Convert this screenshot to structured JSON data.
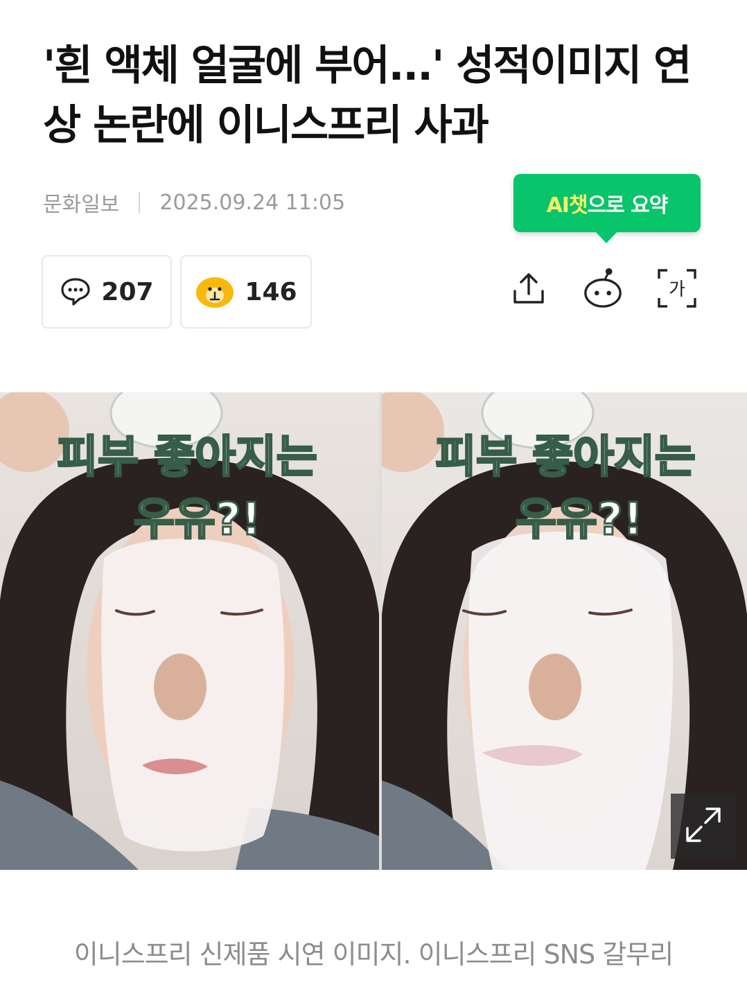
{
  "article": {
    "title": "'흰 액체 얼굴에 부어...' 성적이미지 연상 논란에 이니스프리 사과",
    "source": "문화일보",
    "datetime": "2025.09.24 11:05"
  },
  "ai_summary": {
    "highlight": "AI챗",
    "rest": "으로 요약"
  },
  "stats": {
    "comments": "207",
    "reactions": "146"
  },
  "toolbar": {
    "icons": [
      "share-icon",
      "bot-icon",
      "font-size-icon"
    ],
    "font_glyph": "가"
  },
  "photo": {
    "overlay_line1": "피부 좋아지는",
    "overlay_line2": "우유?!",
    "caption": "이니스프리 신제품 시연 이미지. 이니스프리 SNS 갈무리"
  },
  "colors": {
    "accent_green": "#08c46a",
    "ai_yellow": "#f6f06a",
    "meta_gray": "#9a9a9a"
  }
}
